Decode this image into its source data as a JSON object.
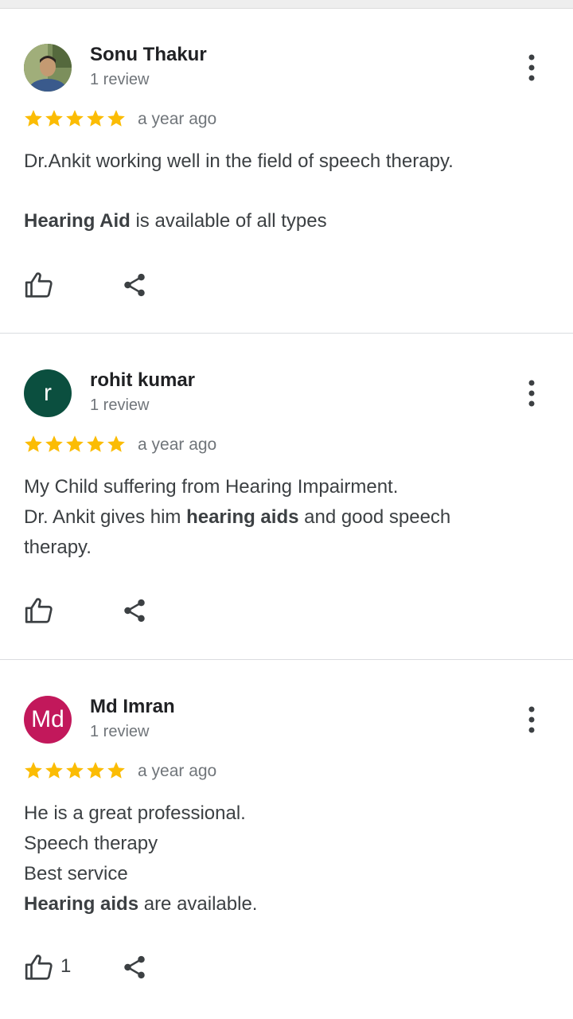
{
  "reviews": [
    {
      "name": "Sonu Thakur",
      "review_count": "1 review",
      "rating": 5,
      "time": "a year ago",
      "avatar_type": "photo",
      "line1": "Dr.Ankit working well in the field of speech therapy.",
      "line2_bold": "Hearing Aid",
      "line2_rest": " is available of all types",
      "likes": ""
    },
    {
      "name": "rohit kumar",
      "review_count": "1 review",
      "rating": 5,
      "time": "a year ago",
      "avatar_letter": "r",
      "avatar_color": "#0b4f3f",
      "line1": "My Child suffering from Hearing Impairment.",
      "line2_pre": "Dr. Ankit gives him ",
      "line2_bold": "hearing aids",
      "line2_rest": " and good speech therapy.",
      "likes": ""
    },
    {
      "name": "Md Imran",
      "review_count": "1 review",
      "rating": 5,
      "time": "a year ago",
      "avatar_letter": "Md",
      "avatar_color": "#c2185b",
      "line1": "He is a great professional.",
      "line2": "Speech therapy",
      "line3": "Best service",
      "line4_bold": "Hearing aids",
      "line4_rest": " are available.",
      "likes": "1"
    }
  ],
  "colors": {
    "star": "#fbbc04",
    "text": "#3c4043",
    "muted": "#70757a"
  },
  "icons": [
    "more-vert-icon",
    "star-icon",
    "thumb-up-icon",
    "share-icon"
  ]
}
